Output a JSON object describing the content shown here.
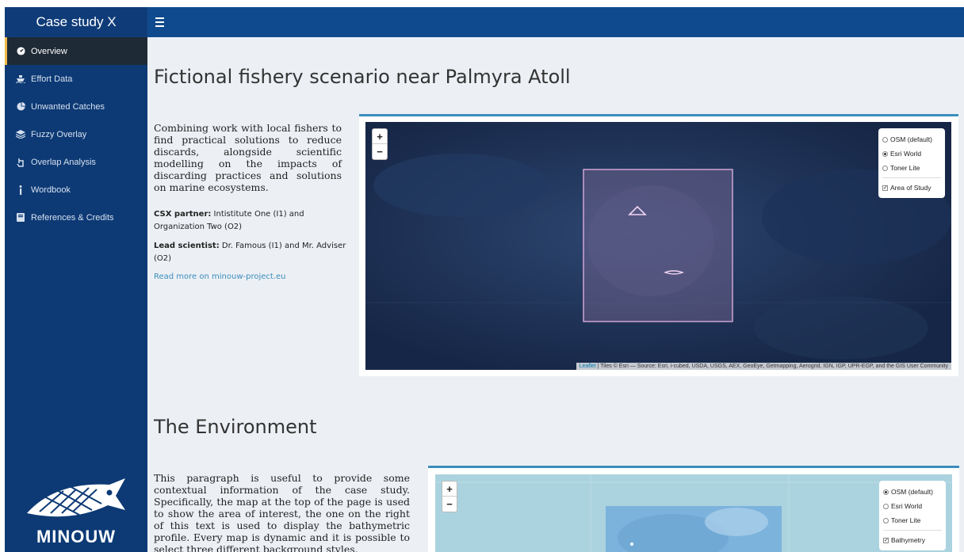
{
  "app": {
    "title": "Case study X"
  },
  "sidebar": {
    "items": [
      {
        "label": "Overview",
        "icon": "dashboard-icon",
        "active": true
      },
      {
        "label": "Effort Data",
        "icon": "ship-icon"
      },
      {
        "label": "Unwanted Catches",
        "icon": "pie-chart-icon"
      },
      {
        "label": "Fuzzy Overlay",
        "icon": "layers-icon"
      },
      {
        "label": "Overlap Analysis",
        "icon": "hand-icon"
      },
      {
        "label": "Wordbook",
        "icon": "info-icon"
      },
      {
        "label": "References & Credits",
        "icon": "book-icon"
      }
    ],
    "logo_text": "MINOUW"
  },
  "section1": {
    "title": "Fictional fishery scenario near Palmyra Atoll",
    "lead": "Combining work with local fishers to find practical solutions to reduce discards, alongside scientific modelling on the impacts of discarding practices and solutions on marine ecosystems.",
    "partner_label": "CSX partner:",
    "partner_value": " Intistitute One (I1) and Organization Two (O2)",
    "scientist_label": "Lead scientist:",
    "scientist_value": " Dr. Famous (I1) and Mr. Adviser (O2)",
    "link": "Read more on minouw-project.eu"
  },
  "map1": {
    "zoom_in": "+",
    "zoom_out": "−",
    "layers": [
      "OSM (default)",
      "Esri World",
      "Toner Lite"
    ],
    "selected_layer": "Esri World",
    "overlay": "Area of Study",
    "attribution_link": "Leaflet",
    "attribution_text": " | Tiles © Esri — Source: Esri, i-cubed, USDA, USGS, AEX, GeoEye, Getmapping, Aerogrid, IGN, IGP, UPR-EGP, and the GIS User Community"
  },
  "section2": {
    "title": "The Environment",
    "paragraph": "This paragraph is useful to provide some contextual information of the case study. Specifically, the map at the top of the page is used to show the area of interest, the one on the right of this text is used to display the bathymetric profile. Every map is dynamic and it is possible to select three different background styles."
  },
  "map2": {
    "zoom_in": "+",
    "zoom_out": "−",
    "layers": [
      "OSM (default)",
      "Esri World",
      "Toner Lite"
    ],
    "selected_layer": "OSM (default)",
    "overlay": "Bathymetry"
  },
  "colors": {
    "brand": "#0f3c78",
    "topbar": "#104a8e",
    "sidebar": "#0d3a75",
    "accent": "#3c8dbc"
  }
}
